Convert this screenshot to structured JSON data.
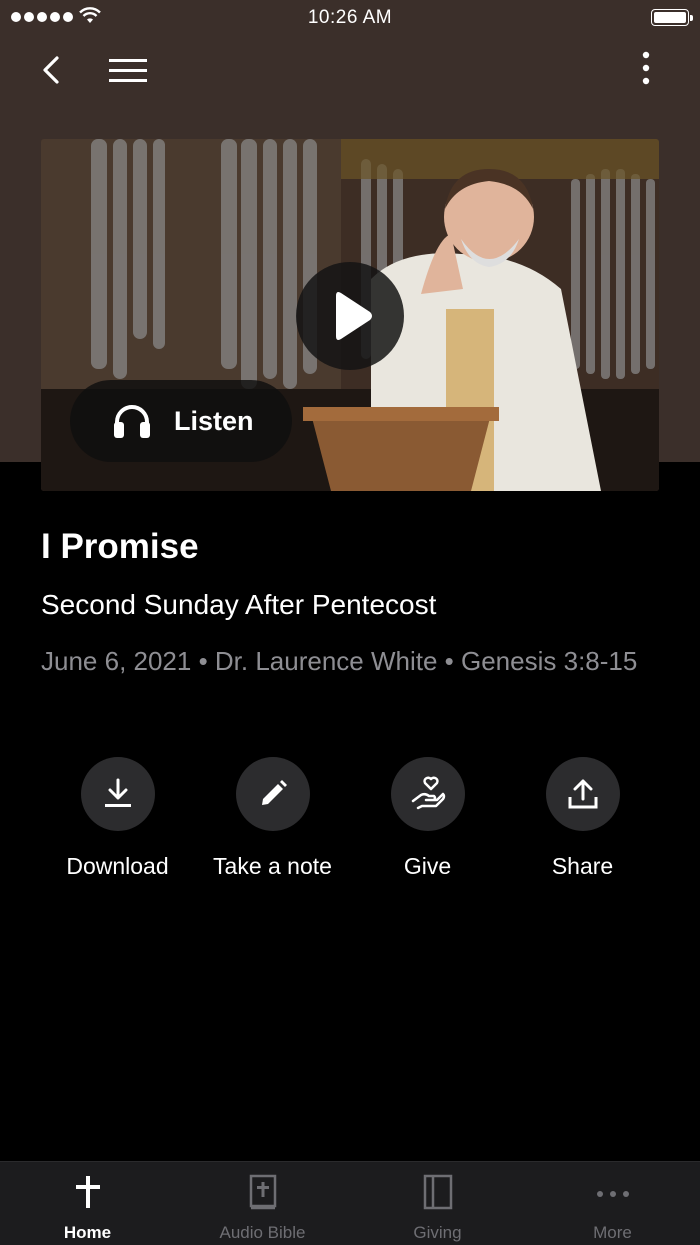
{
  "status": {
    "time": "10:26 AM"
  },
  "hero": {
    "listen_label": "Listen"
  },
  "sermon": {
    "title": "I Promise",
    "subtitle": "Second Sunday After Pentecost",
    "meta": "June 6, 2021 • Dr. Laurence White • Genesis 3:8-15"
  },
  "actions": [
    {
      "label": "Download",
      "icon": "download-icon"
    },
    {
      "label": "Take a note",
      "icon": "pencil-icon"
    },
    {
      "label": "Give",
      "icon": "heart-hand-icon"
    },
    {
      "label": "Share",
      "icon": "share-icon"
    }
  ],
  "tabs": [
    {
      "label": "Home",
      "icon": "cross-icon",
      "active": true
    },
    {
      "label": "Audio Bible",
      "icon": "bible-icon",
      "active": false
    },
    {
      "label": "Giving",
      "icon": "book-icon",
      "active": false
    },
    {
      "label": "More",
      "icon": "ellipsis-icon",
      "active": false
    }
  ],
  "colors": {
    "header_bg": "#3b2f2a",
    "background": "#000000",
    "tabbar_bg": "#1c1c1e",
    "muted_text": "#8e8e93"
  }
}
